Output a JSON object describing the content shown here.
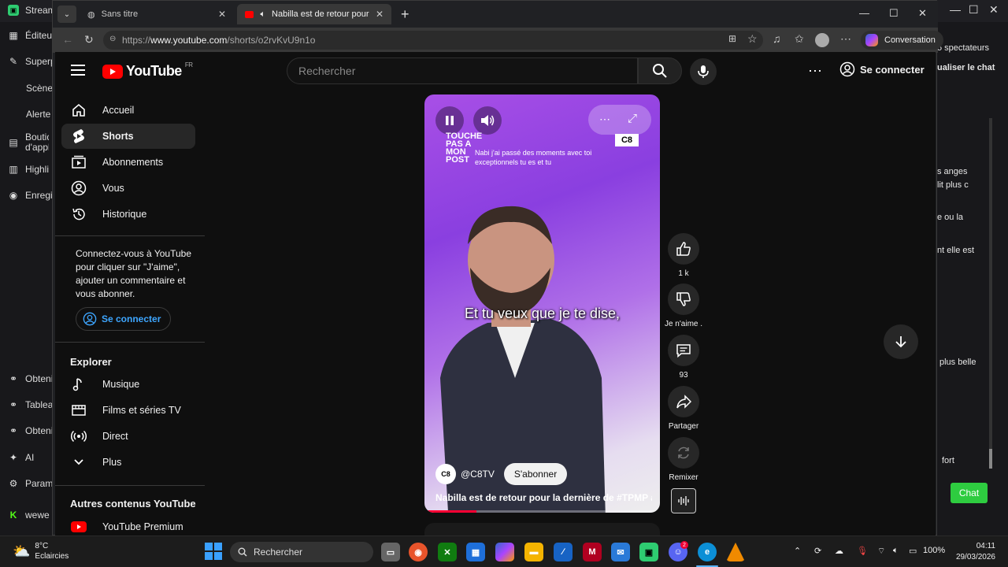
{
  "background_app": {
    "sidebar_items": [
      {
        "label": "Stream",
        "icon": "app-icon"
      },
      {
        "label": "Éditeu",
        "icon": "layout-icon"
      },
      {
        "label": "Superp",
        "icon": "sliders-icon"
      },
      {
        "label": "Scène",
        "icon": ""
      },
      {
        "label": "Alerte",
        "icon": ""
      },
      {
        "label": "Boutiq d'appli",
        "icon": "shop-icon"
      },
      {
        "label": "Highli",
        "icon": "highlight-icon"
      },
      {
        "label": "Enregi",
        "icon": "record-icon"
      },
      {
        "label": "Obteni",
        "icon": "link-icon"
      },
      {
        "label": "Tablea",
        "icon": "link-icon"
      },
      {
        "label": "Obteni",
        "icon": "link-icon"
      },
      {
        "label": "AI",
        "icon": "sparkle-icon"
      },
      {
        "label": "Param",
        "icon": "settings-icon"
      },
      {
        "label": "wewe",
        "icon": "k-icon"
      }
    ],
    "right_texts": [
      "5 spectateurs",
      "ualiser le chat",
      "s anges",
      "lit plus c",
      "e ou la",
      "nt elle est",
      "plus belle",
      "fort"
    ],
    "chat_button": "Chat"
  },
  "browser": {
    "tabs": [
      {
        "title": "Sans titre",
        "active": false
      },
      {
        "title": "Nabilla est de retour pour la d",
        "active": true
      }
    ],
    "new_tab": "+",
    "url_prefix": "https://",
    "url_host": "www.youtube.com",
    "url_path": "/shorts/o2rvKvU9n1o",
    "copilot_label": "Conversation"
  },
  "youtube": {
    "logo_text": "YouTube",
    "region": "FR",
    "search_placeholder": "Rechercher",
    "signin_label": "Se connecter",
    "sidebar": {
      "main": [
        {
          "label": "Accueil",
          "icon": "home-icon",
          "selected": false
        },
        {
          "label": "Shorts",
          "icon": "shorts-icon",
          "selected": true
        },
        {
          "label": "Abonnements",
          "icon": "subscriptions-icon",
          "selected": false
        },
        {
          "label": "Vous",
          "icon": "user-icon",
          "selected": false
        },
        {
          "label": "Historique",
          "icon": "history-icon",
          "selected": false
        }
      ],
      "signin_message": "Connectez-vous à YouTube pour cliquer sur \"J'aime\", ajouter un commentaire et vous abonner.",
      "signin_button": "Se connecter",
      "explore_heading": "Explorer",
      "explore": [
        {
          "label": "Musique",
          "icon": "music-icon"
        },
        {
          "label": "Films et séries TV",
          "icon": "film-icon"
        },
        {
          "label": "Direct",
          "icon": "live-icon"
        },
        {
          "label": "Plus",
          "icon": "chevron-down-icon"
        }
      ],
      "more_heading": "Autres contenus YouTube",
      "more": [
        {
          "label": "YouTube Premium",
          "icon": "youtube-premium-icon"
        }
      ]
    },
    "short": {
      "overlay_show": "TOUCHE PAS A MON POST",
      "overlay_caption": "Nabi j'ai passé des moments avec toi exceptionnels tu es et tu",
      "channel_badge": "C8",
      "subtitle": "Et tu veux que je te dise,",
      "channel_handle": "@C8TV",
      "subscribe_label": "S'abonner",
      "title": "Nabilla est de retour pour la dernière de #TPMP au...",
      "progress": 0.22
    },
    "actions": [
      {
        "label": "1 k",
        "icon": "thumbs-up-icon"
      },
      {
        "label": "Je n'aime .",
        "icon": "thumbs-down-icon"
      },
      {
        "label": "93",
        "icon": "comment-icon"
      },
      {
        "label": "Partager",
        "icon": "share-icon"
      },
      {
        "label": "Remixer",
        "icon": "remix-icon"
      }
    ]
  },
  "taskbar": {
    "temperature": "8°C",
    "weather": "Eclaircies",
    "search_label": "Rechercher",
    "battery": "100%",
    "time": "04:11",
    "date": "29/03/2026"
  }
}
